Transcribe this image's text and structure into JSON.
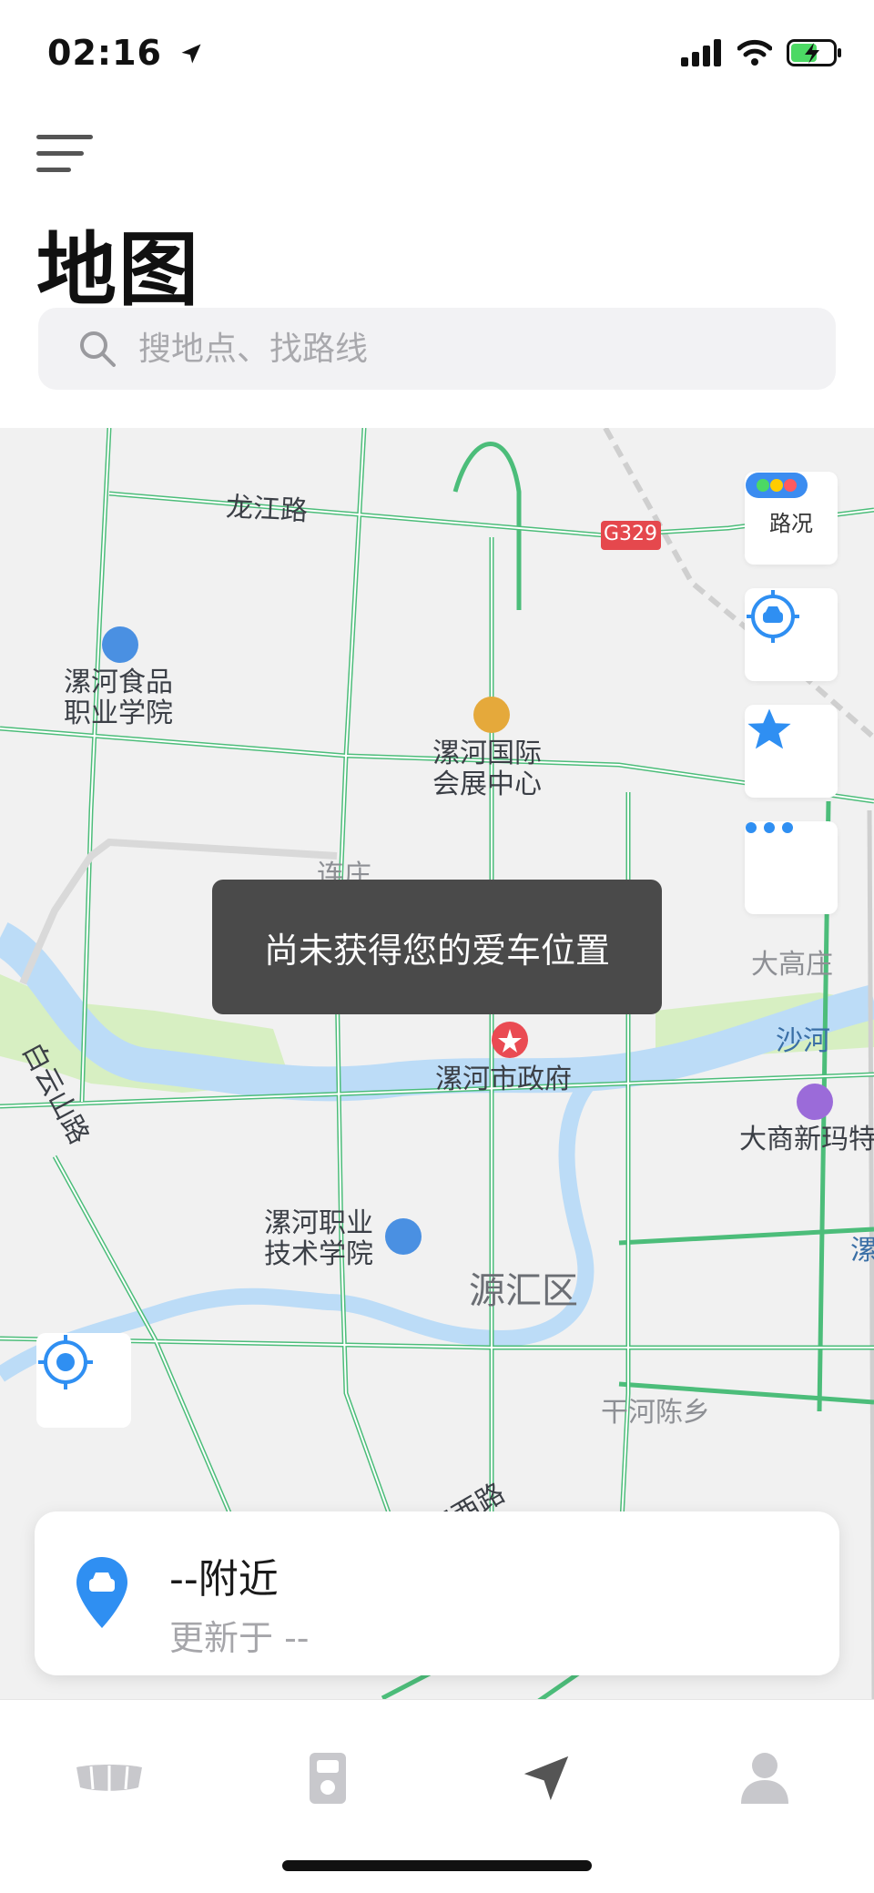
{
  "status_bar": {
    "time": "02:16"
  },
  "header": {
    "title": "地图"
  },
  "search": {
    "placeholder": "搜地点、找路线"
  },
  "map": {
    "labels": {
      "longjiang": "龙江路",
      "g329": "G329",
      "food_college_1": "漯河食品",
      "food_college_2": "职业学院",
      "expo_1": "漯河国际",
      "expo_2": "会展中心",
      "liandian": "连庄",
      "dagao": "大高庄",
      "shahe": "沙河",
      "baiyunshan": "白云山路",
      "city_gov": "漯河市政府",
      "dashang": "大商新玛特",
      "luo": "漯",
      "voc_college_1": "漯河职业",
      "voc_college_2": "技术学院",
      "district": "源汇区",
      "ganhe": "干河陈乡",
      "xiangjiang": "湘江西路"
    },
    "controls": {
      "traffic_label": "路况"
    }
  },
  "toast": {
    "message": "尚未获得您的爱车位置"
  },
  "location_card": {
    "title": "--附近",
    "subtitle": "更新于 --"
  },
  "colors": {
    "road": "#4cbd7a",
    "water": "#bcdcf7",
    "park": "#d7efc2",
    "accent": "#2f8ff2"
  }
}
